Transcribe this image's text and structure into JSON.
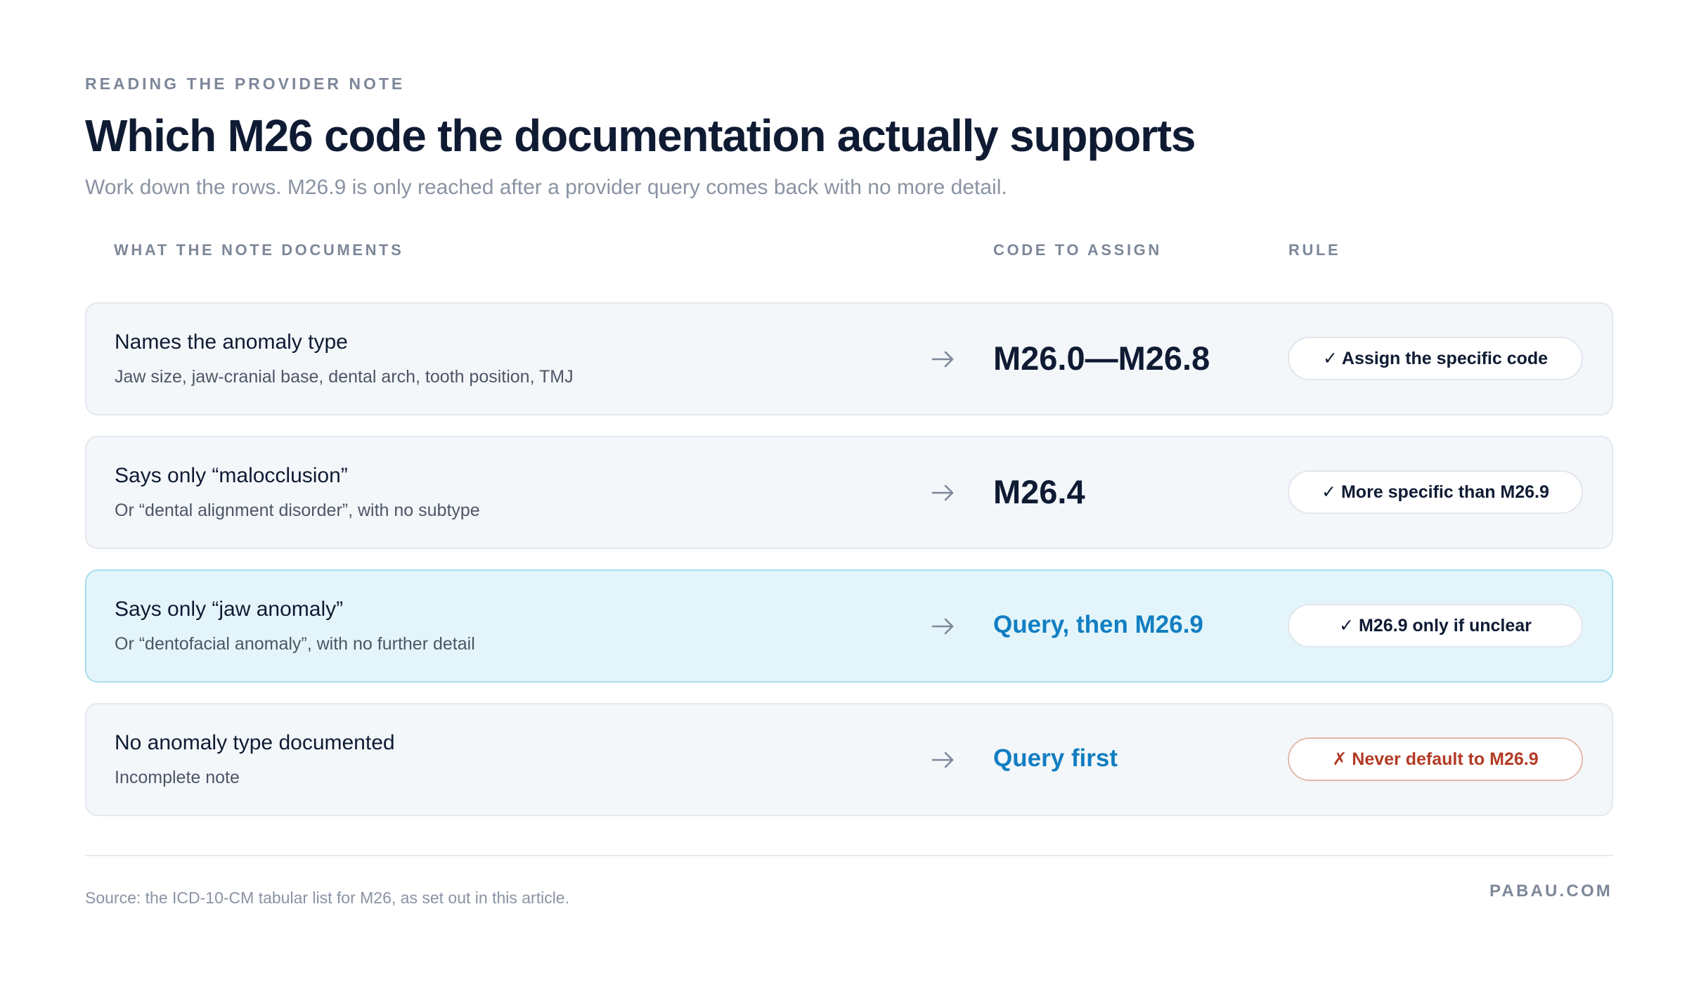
{
  "header": {
    "eyebrow": "READING THE PROVIDER NOTE",
    "title": "Which M26 code the documentation actually supports",
    "subtitle": "Work down the rows. M26.9 is only reached after a provider query comes back with no more detail."
  },
  "columns": {
    "documents": "WHAT THE NOTE DOCUMENTS",
    "code": "CODE TO ASSIGN",
    "rule": "RULE"
  },
  "rows": [
    {
      "primary": "Names the anomaly type",
      "secondary": "Jaw size, jaw-cranial base, dental arch, tooth position, TMJ",
      "code": "M26.0—M26.8",
      "rule": "✓ Assign the specific code"
    },
    {
      "primary": "Says only “malocclusion”",
      "secondary": "Or “dental alignment disorder”, with no subtype",
      "code": "M26.4",
      "rule": "✓ More specific than M26.9"
    },
    {
      "primary": "Says only “jaw anomaly”",
      "secondary": "Or “dentofacial anomaly”, with no further detail",
      "code": "Query, then M26.9",
      "rule": "✓ M26.9 only if unclear"
    },
    {
      "primary": "No anomaly type documented",
      "secondary": "Incomplete note",
      "code": "Query first",
      "rule": "✗ Never default to M26.9"
    }
  ],
  "footer": {
    "source": "Source: the ICD-10-CM tabular list for M26, as set out in this article.",
    "brand": "PABAU.COM"
  },
  "colors": {
    "accent": "#127ec2",
    "highlight_bg": "#e3f5fa",
    "warning": "#b23b24",
    "ink": "#0f1b33"
  },
  "icons": {
    "row_arrow": "arrow-right-icon"
  }
}
